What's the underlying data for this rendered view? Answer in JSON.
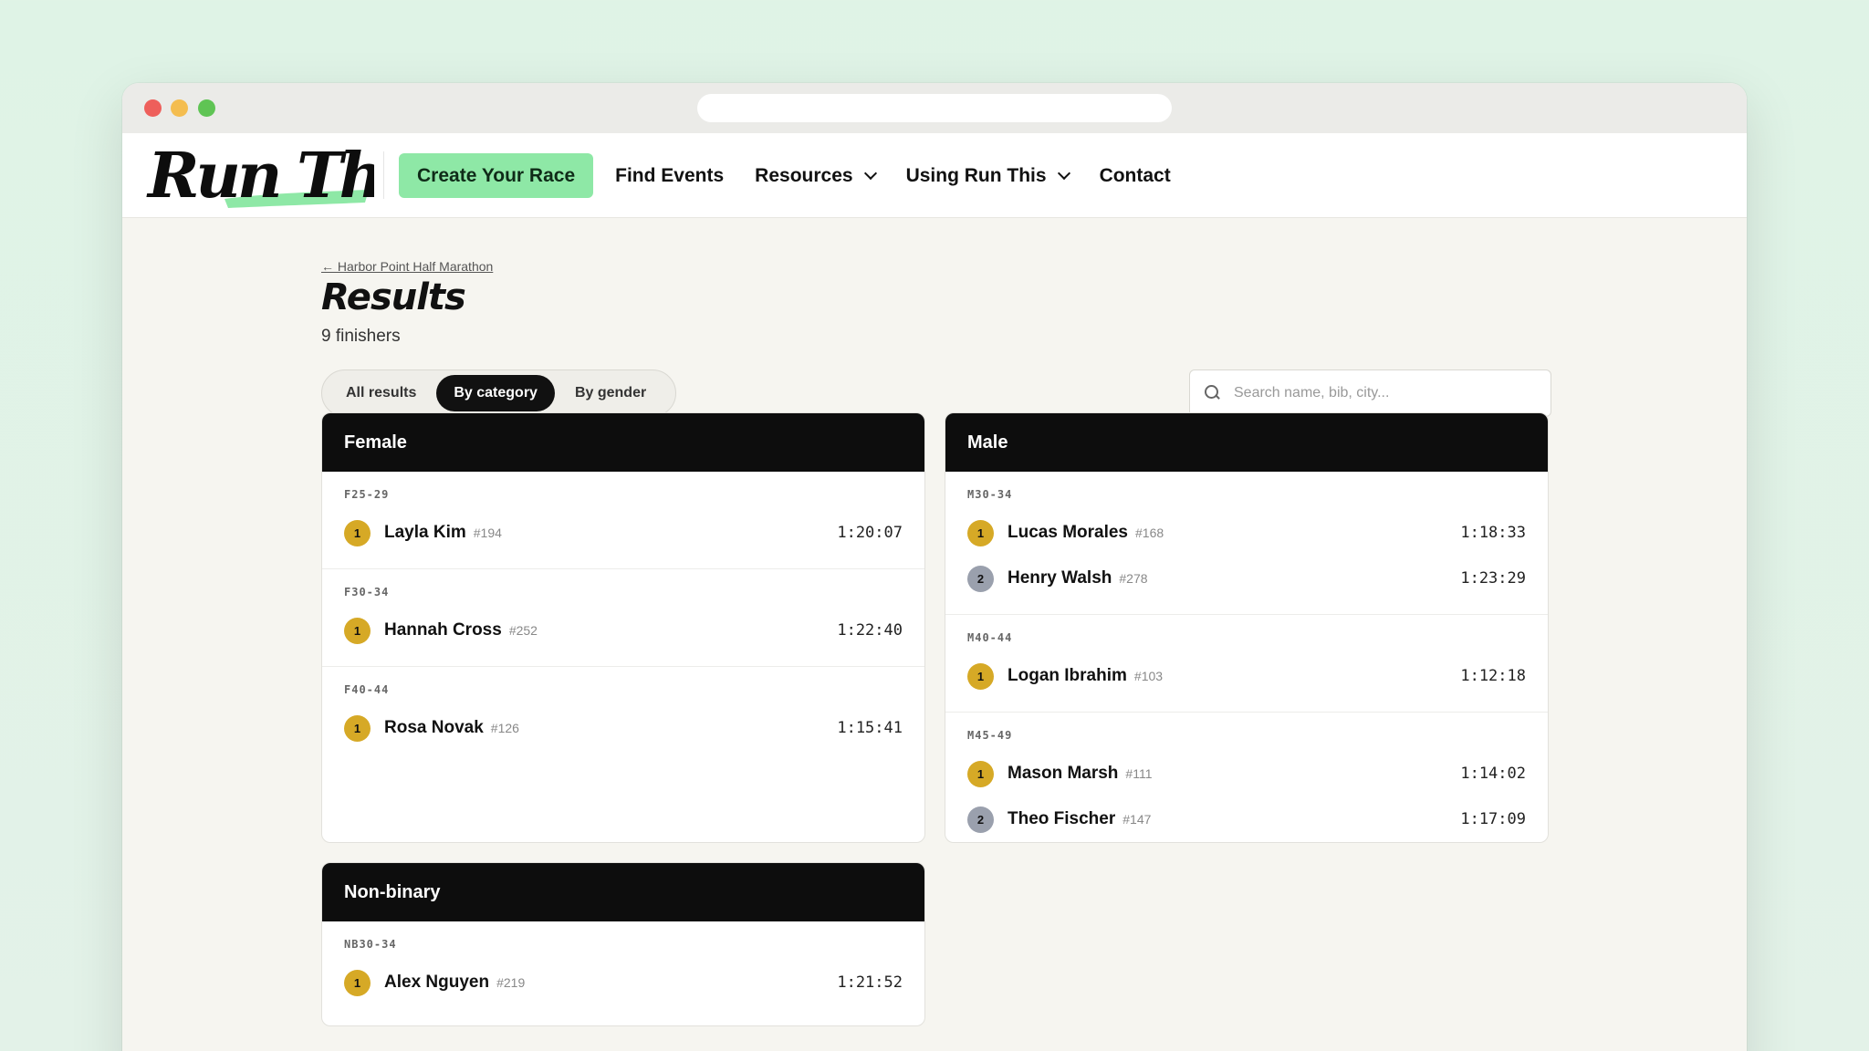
{
  "nav": {
    "logo_text": "Run This",
    "cta": "Create Your Race",
    "links": [
      "Find Events",
      "Resources",
      "Using Run This",
      "Contact"
    ]
  },
  "page": {
    "breadcrumb": "← Harbor Point Half Marathon",
    "title": "Results",
    "finisher_count": "9 finishers"
  },
  "filters": {
    "tabs": [
      "All results",
      "By category",
      "By gender"
    ],
    "active": "By category",
    "search_placeholder": "Search name, bib, city..."
  },
  "colors": {
    "cta": "#8ee8a6",
    "gold": "#d6a926",
    "silver": "#9aa0ad",
    "header": "#0d0d0d"
  },
  "divisions": [
    {
      "title": "Female",
      "groups": [
        {
          "label": "F25-29",
          "rows": [
            {
              "place": "1",
              "name": "Layla Kim",
              "bib": "#194",
              "time": "1:20:07"
            }
          ]
        },
        {
          "label": "F30-34",
          "rows": [
            {
              "place": "1",
              "name": "Hannah Cross",
              "bib": "#252",
              "time": "1:22:40"
            }
          ]
        },
        {
          "label": "F40-44",
          "rows": [
            {
              "place": "1",
              "name": "Rosa Novak",
              "bib": "#126",
              "time": "1:15:41"
            }
          ]
        }
      ]
    },
    {
      "title": "Male",
      "groups": [
        {
          "label": "M30-34",
          "rows": [
            {
              "place": "1",
              "name": "Lucas Morales",
              "bib": "#168",
              "time": "1:18:33"
            },
            {
              "place": "2",
              "name": "Henry Walsh",
              "bib": "#278",
              "time": "1:23:29"
            }
          ]
        },
        {
          "label": "M40-44",
          "rows": [
            {
              "place": "1",
              "name": "Logan Ibrahim",
              "bib": "#103",
              "time": "1:12:18"
            }
          ]
        },
        {
          "label": "M45-49",
          "rows": [
            {
              "place": "1",
              "name": "Mason Marsh",
              "bib": "#111",
              "time": "1:14:02"
            },
            {
              "place": "2",
              "name": "Theo Fischer",
              "bib": "#147",
              "time": "1:17:09"
            }
          ]
        }
      ]
    },
    {
      "title": "Non-binary",
      "groups": [
        {
          "label": "NB30-34",
          "rows": [
            {
              "place": "1",
              "name": "Alex Nguyen",
              "bib": "#219",
              "time": "1:21:52"
            }
          ]
        }
      ]
    }
  ]
}
